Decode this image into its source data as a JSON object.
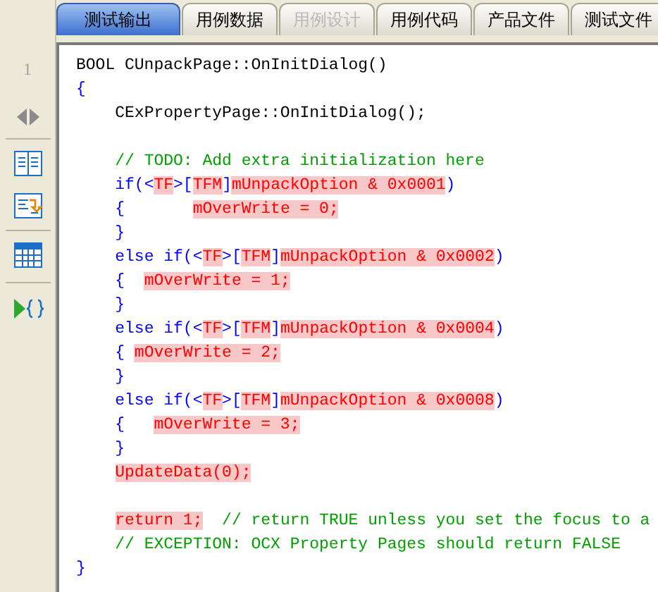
{
  "tabs": [
    {
      "label": "测试输出",
      "selected": true,
      "disabled": false
    },
    {
      "label": "用例数据",
      "selected": false,
      "disabled": false
    },
    {
      "label": "用例设计",
      "selected": false,
      "disabled": true
    },
    {
      "label": "用例代码",
      "selected": false,
      "disabled": false
    },
    {
      "label": "产品文件",
      "selected": false,
      "disabled": false
    },
    {
      "label": "测试文件",
      "selected": false,
      "disabled": false
    }
  ],
  "gutter": {
    "line_number": "1"
  },
  "code_lines": [
    {
      "kind": "code",
      "segments": [
        {
          "text": "BOOL CUnpackPage::OnInitDialog()",
          "kind": "plain"
        }
      ]
    },
    {
      "kind": "code",
      "segments": [
        {
          "text": "{",
          "kind": "syntax"
        }
      ]
    },
    {
      "kind": "code",
      "segments": [
        {
          "text": "    CExPropertyPage::OnInitDialog();",
          "kind": "plain"
        }
      ]
    },
    {
      "kind": "blank"
    },
    {
      "kind": "code",
      "segments": [
        {
          "text": "    // TODO: Add extra initialization here",
          "kind": "comment"
        }
      ]
    },
    {
      "kind": "code",
      "segments": [
        {
          "text": "    if(<",
          "kind": "syntax"
        },
        {
          "text": "TF",
          "kind": "changed"
        },
        {
          "text": ">[",
          "kind": "syntax"
        },
        {
          "text": "TFM",
          "kind": "changed"
        },
        {
          "text": "]",
          "kind": "syntax"
        },
        {
          "text": "mUnpackOption & 0x0001",
          "kind": "changed"
        },
        {
          "text": ")",
          "kind": "syntax"
        }
      ]
    },
    {
      "kind": "code",
      "segments": [
        {
          "text": "    {       ",
          "kind": "syntax"
        },
        {
          "text": "mOverWrite = 0;",
          "kind": "changed"
        }
      ]
    },
    {
      "kind": "code",
      "segments": [
        {
          "text": "    }",
          "kind": "syntax"
        }
      ]
    },
    {
      "kind": "code",
      "segments": [
        {
          "text": "    else if(<",
          "kind": "syntax"
        },
        {
          "text": "TF",
          "kind": "changed"
        },
        {
          "text": ">[",
          "kind": "syntax"
        },
        {
          "text": "TFM",
          "kind": "changed"
        },
        {
          "text": "]",
          "kind": "syntax"
        },
        {
          "text": "mUnpackOption & 0x0002",
          "kind": "changed"
        },
        {
          "text": ")",
          "kind": "syntax"
        }
      ]
    },
    {
      "kind": "code",
      "segments": [
        {
          "text": "    {  ",
          "kind": "syntax"
        },
        {
          "text": "mOverWrite = 1;",
          "kind": "changed"
        }
      ]
    },
    {
      "kind": "code",
      "segments": [
        {
          "text": "    }",
          "kind": "syntax"
        }
      ]
    },
    {
      "kind": "code",
      "segments": [
        {
          "text": "    else if(<",
          "kind": "syntax"
        },
        {
          "text": "TF",
          "kind": "changed"
        },
        {
          "text": ">[",
          "kind": "syntax"
        },
        {
          "text": "TFM",
          "kind": "changed"
        },
        {
          "text": "]",
          "kind": "syntax"
        },
        {
          "text": "mUnpackOption & 0x0004",
          "kind": "changed"
        },
        {
          "text": ")",
          "kind": "syntax"
        }
      ]
    },
    {
      "kind": "code",
      "segments": [
        {
          "text": "    { ",
          "kind": "syntax"
        },
        {
          "text": "mOverWrite = 2;",
          "kind": "changed"
        }
      ]
    },
    {
      "kind": "code",
      "segments": [
        {
          "text": "    }",
          "kind": "syntax"
        }
      ]
    },
    {
      "kind": "code",
      "segments": [
        {
          "text": "    else if(<",
          "kind": "syntax"
        },
        {
          "text": "TF",
          "kind": "changed"
        },
        {
          "text": ">[",
          "kind": "syntax"
        },
        {
          "text": "TFM",
          "kind": "changed"
        },
        {
          "text": "]",
          "kind": "syntax"
        },
        {
          "text": "mUnpackOption & 0x0008",
          "kind": "changed"
        },
        {
          "text": ")",
          "kind": "syntax"
        }
      ]
    },
    {
      "kind": "code",
      "segments": [
        {
          "text": "    {   ",
          "kind": "syntax"
        },
        {
          "text": "mOverWrite = 3;",
          "kind": "changed"
        }
      ]
    },
    {
      "kind": "code",
      "segments": [
        {
          "text": "    }",
          "kind": "syntax"
        }
      ]
    },
    {
      "kind": "code",
      "segments": [
        {
          "text": "    UpdateData(0);",
          "kind": "changed"
        }
      ]
    },
    {
      "kind": "blank"
    },
    {
      "kind": "code",
      "segments": [
        {
          "text": "    return 1;",
          "kind": "changed"
        },
        {
          "text": "  // return TRUE unless you set the focus to a",
          "kind": "comment"
        }
      ]
    },
    {
      "kind": "code",
      "segments": [
        {
          "text": "    // EXCEPTION: OCX Property Pages should return FALSE",
          "kind": "comment"
        }
      ]
    },
    {
      "kind": "code",
      "segments": [
        {
          "text": "}",
          "kind": "syntax"
        }
      ]
    }
  ]
}
